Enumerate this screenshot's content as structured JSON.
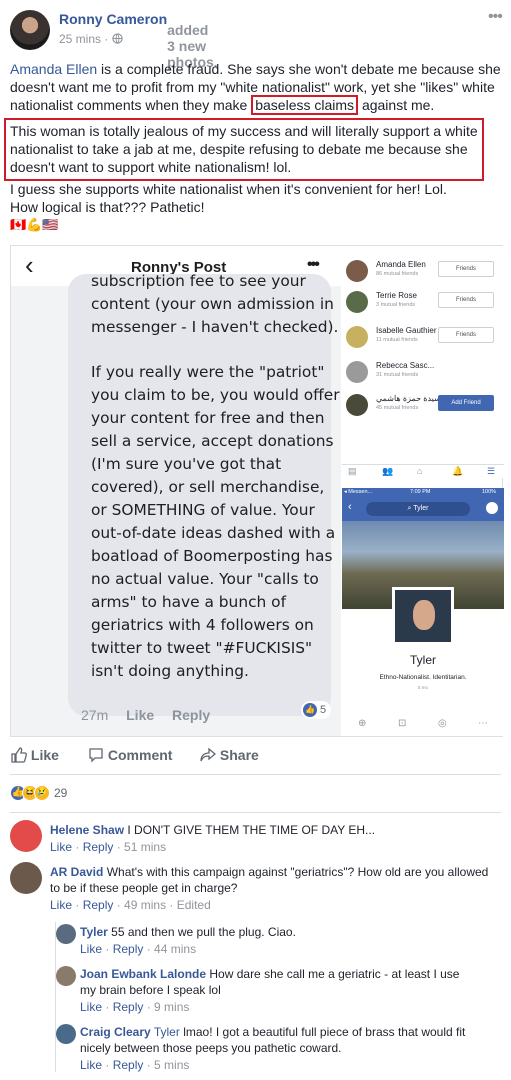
{
  "post": {
    "author": "Ronny Cameron",
    "action": "added 3 new photos.",
    "time": "25 mins",
    "more": "•••",
    "mention": "Amanda Ellen",
    "text_a": " is a complete fraud. She says she won't debate me because she doesn't want me to profit from my \"white nationalist\" work, yet she \"likes\" white nationalist comments when they make ",
    "highlight": "baseless claims",
    "text_b": " against me.",
    "text_box": "This woman is totally jealous of my success and will literally support a white nationalist to take a jab at me, despite refusing to debate me because she doesn't want to support white nationalism! lol.",
    "text_c": "I guess she supports white nationalist when it's convenient for her! Lol.",
    "text_d": "How logical is that??? Pathetic!",
    "emojis": "🇨🇦💪🇺🇸"
  },
  "screenshot_left": {
    "title": "Ronny's Post",
    "back": "‹",
    "more": "•••",
    "msg_p1": "subscription fee to see your content (your own admission in messenger - I haven't checked).",
    "msg_p2": "If you really were the \"patriot\" you claim to be, you would offer your content for free and then sell a service, accept donations (I'm sure you've got that covered), or sell merchandise, or SOMETHING of value. Your out-of-date ideas dashed with a boatload of Boomerposting has no actual value. Your \"calls to arms\" to have a bunch of geriatrics with 4 followers on twitter to tweet \"#FUCKISIS\" isn't doing anything.",
    "time": "27m",
    "like": "Like",
    "reply": "Reply",
    "like_count": "5"
  },
  "friends": [
    {
      "name": "Amanda Ellen",
      "mutual": "86 mutual friends",
      "btn": "Friends",
      "primary": false
    },
    {
      "name": "Terrie Rose",
      "mutual": "3 mutual friends",
      "btn": "Friends",
      "primary": false
    },
    {
      "name": "Isabelle Gauthier",
      "mutual": "11 mutual friends",
      "btn": "Friends",
      "primary": false
    },
    {
      "name": "Rebecca Sasc...",
      "mutual": "31 mutual friends",
      "btn": "",
      "primary": false
    },
    {
      "name": "سيدة حمزة هاشمي",
      "mutual": "45 mutual friends",
      "btn": "Add Friend",
      "primary": true
    }
  ],
  "tyler_screen": {
    "status_left": "◂ Messen...",
    "time": "7:09 PM",
    "battery": "100%",
    "search": "Tyler",
    "name": "Tyler",
    "bio": "Ethno-Nationalist. Identitarian.",
    "sub": "5 mo"
  },
  "actions": {
    "like": "Like",
    "comment": "Comment",
    "share": "Share"
  },
  "reactions": {
    "count": "29"
  },
  "comments": [
    {
      "author": "Helene Shaw",
      "text": "I DON'T GIVE THEM THE TIME OF DAY EH...",
      "like": "Like",
      "reply": "Reply",
      "time": "51 mins",
      "edited": ""
    },
    {
      "author": "AR David",
      "text": "What's with this campaign against \"geriatrics\"? How old are you allowed to be if these people get in charge?",
      "like": "Like",
      "reply": "Reply",
      "time": "49 mins",
      "edited": "Edited"
    },
    {
      "author": "Tyler",
      "text": "55 and then we pull the plug. Ciao.",
      "like": "Like",
      "reply": "Reply",
      "time": "44 mins",
      "edited": ""
    },
    {
      "author": "Joan Ewbank Lalonde",
      "text": "How dare she call me a geriatric - at least I use my brain before I speak lol",
      "like": "Like",
      "reply": "Reply",
      "time": "9 mins",
      "edited": ""
    },
    {
      "author": "Craig Cleary",
      "mention": "Tyler",
      "text": "lmao! I got a beautiful full piece of brass that would fit nicely between those peeps you pathetic coward.",
      "like": "Like",
      "reply": "Reply",
      "time": "5 mins",
      "edited": ""
    }
  ],
  "colors": {
    "brand": "#365899",
    "red_box": "#d11a2a",
    "meta": "#90949c"
  }
}
